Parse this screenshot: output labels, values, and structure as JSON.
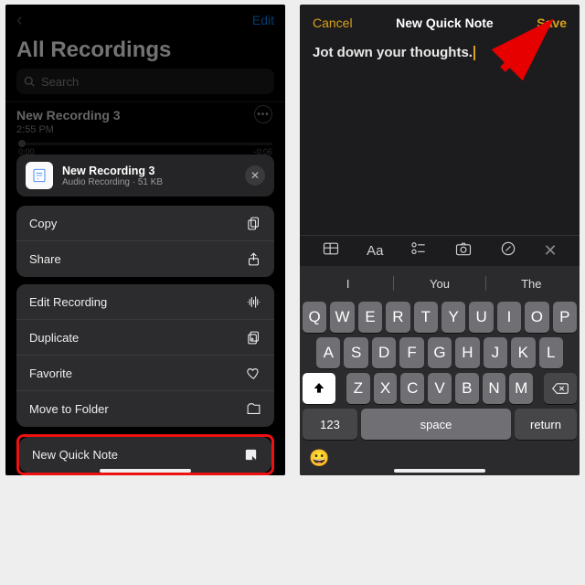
{
  "left": {
    "edit": "Edit",
    "title": "All Recordings",
    "search_placeholder": "Search",
    "recording": {
      "title": "New Recording 3",
      "time": "2:55 PM"
    },
    "scrub": {
      "start": "0:00",
      "end": "-0:06"
    },
    "attachment": {
      "title": "New Recording 3",
      "sub": "Audio Recording · 51 KB"
    },
    "menu": {
      "copy": "Copy",
      "share": "Share",
      "edit_recording": "Edit Recording",
      "duplicate": "Duplicate",
      "favorite": "Favorite",
      "move": "Move to Folder",
      "new_quick_note": "New Quick Note"
    }
  },
  "right": {
    "cancel": "Cancel",
    "title": "New Quick Note",
    "save": "Save",
    "note_text": "Jot down your thoughts.",
    "toolbar_aa": "Aa",
    "suggestions": {
      "a": "I",
      "b": "You",
      "c": "The"
    },
    "keys": {
      "r1": [
        "Q",
        "W",
        "E",
        "R",
        "T",
        "Y",
        "U",
        "I",
        "O",
        "P"
      ],
      "r2": [
        "A",
        "S",
        "D",
        "F",
        "G",
        "H",
        "J",
        "K",
        "L"
      ],
      "r3": [
        "Z",
        "X",
        "C",
        "V",
        "B",
        "N",
        "M"
      ],
      "numkey": "123",
      "space": "space",
      "return": "return"
    }
  }
}
